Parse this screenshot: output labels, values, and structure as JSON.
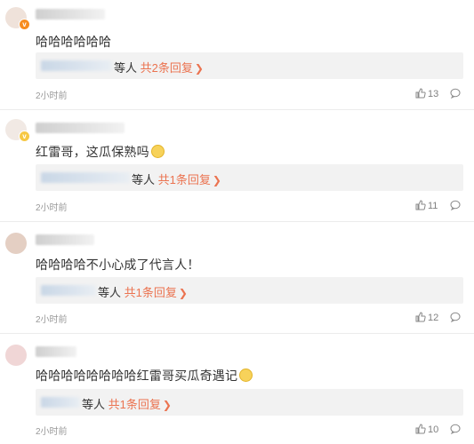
{
  "comments": [
    {
      "text": "哈哈哈哈哈哈",
      "reply_suffix": "等人",
      "reply_link": "共2条回复",
      "time": "2小时前",
      "likes": "13",
      "emoji": false
    },
    {
      "text": "红雷哥，这瓜保熟吗",
      "reply_suffix": "等人",
      "reply_link": "共1条回复",
      "time": "2小时前",
      "likes": "11",
      "emoji": true
    },
    {
      "text": "哈哈哈哈不小心成了代言人！",
      "reply_suffix": "等人",
      "reply_link": "共1条回复",
      "time": "2小时前",
      "likes": "12",
      "emoji": false
    },
    {
      "text": "哈哈哈哈哈哈哈哈红雷哥买瓜奇遇记",
      "reply_suffix": "等人",
      "reply_link": "共1条回复",
      "time": "2小时前",
      "likes": "10",
      "emoji": true
    }
  ],
  "icons": {
    "like": "thumbs-up-icon",
    "more": "comment-bubble-icon",
    "chevron": "chevron-right-icon",
    "verified": "verified-badge-icon"
  },
  "colors": {
    "reply_link": "#eb7350",
    "reply_bg": "#f2f2f2",
    "meta": "#999999",
    "text": "#333333"
  }
}
